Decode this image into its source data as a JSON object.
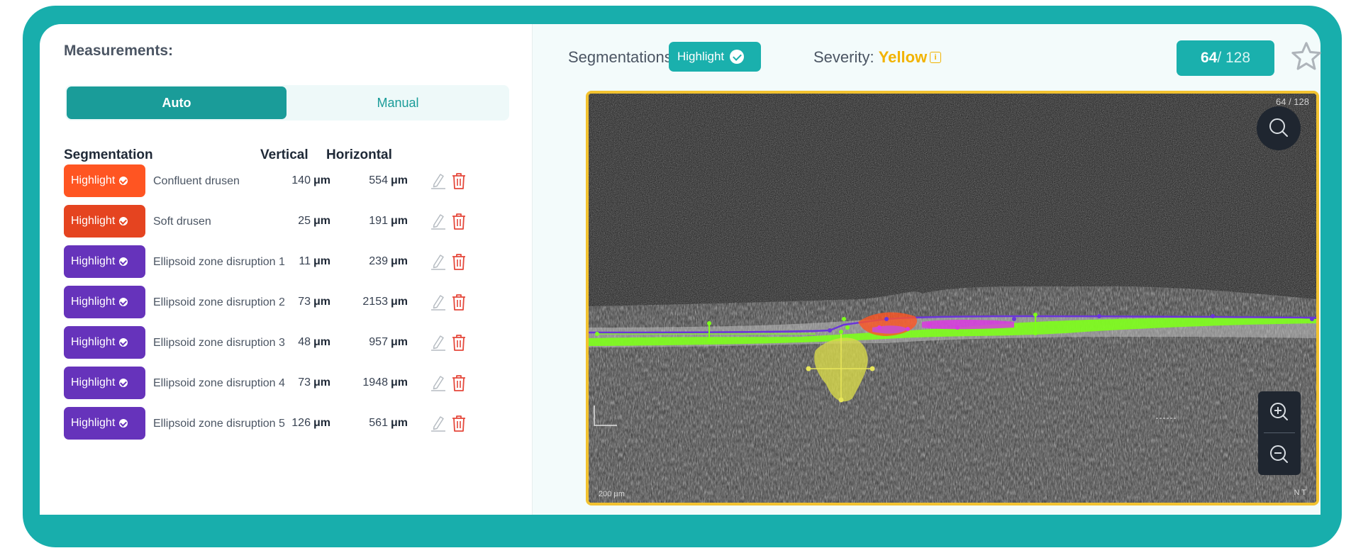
{
  "measurements": {
    "title": "Measurements:",
    "modes": {
      "auto": "Auto",
      "manual": "Manual",
      "selected": "Auto"
    },
    "columns": {
      "segmentation": "Segmentation",
      "vertical": "Vertical",
      "horizontal": "Horizontal"
    },
    "rows": [
      {
        "badge": "Highlight",
        "badge_color": "#ff5522",
        "name": "Confluent drusen",
        "vertical": "140",
        "horizontal": "554",
        "unit": "μm"
      },
      {
        "badge": "Highlight",
        "badge_color": "#e54420",
        "name": "Soft drusen",
        "vertical": "25",
        "horizontal": "191",
        "unit": "μm"
      },
      {
        "badge": "Highlight",
        "badge_color": "#6633bb",
        "name": "Ellipsoid zone disruption 1",
        "vertical": "11",
        "horizontal": "239",
        "unit": "μm"
      },
      {
        "badge": "Highlight",
        "badge_color": "#6633bb",
        "name": "Ellipsoid zone disruption 2",
        "vertical": "73",
        "horizontal": "2153",
        "unit": "μm"
      },
      {
        "badge": "Highlight",
        "badge_color": "#6633bb",
        "name": "Ellipsoid zone disruption 3",
        "vertical": "48",
        "horizontal": "957",
        "unit": "μm"
      },
      {
        "badge": "Highlight",
        "badge_color": "#6633bb",
        "name": "Ellipsoid zone disruption 4",
        "vertical": "73",
        "horizontal": "1948",
        "unit": "μm"
      },
      {
        "badge": "Highlight",
        "badge_color": "#6633bb",
        "name": "Ellipsoid zone disruption 5",
        "vertical": "126",
        "horizontal": "561",
        "unit": "μm"
      }
    ]
  },
  "viewer_header": {
    "segmentations_label": "Segmentations:",
    "segmentations_badge": "Highlight",
    "severity_label": "Severity:",
    "severity_value": "Yellow",
    "severity_color": "#f2b300",
    "info_icon": "i",
    "slice_current": "64",
    "slice_total": "/ 128",
    "favorite_icon": "star-outline-icon"
  },
  "viewer": {
    "slice_indicator": "64 / 128",
    "scale_bar": "200 μm",
    "orientation": "N  T",
    "top_left_marker": "I",
    "border_color": "#f2c230",
    "icons": [
      "search-icon",
      "zoom-in-icon",
      "zoom-out-icon"
    ]
  }
}
